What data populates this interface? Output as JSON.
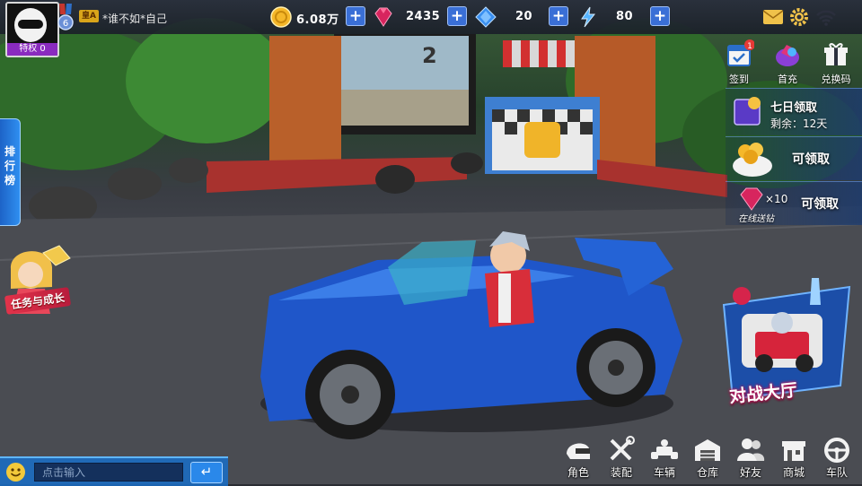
{
  "player": {
    "vip_label": "特权",
    "vip_level": "0",
    "medal_level": "6",
    "rank_badge": "皇A",
    "name": "*谁不如*自己"
  },
  "resources": [
    {
      "name": "coins",
      "icon": "gold-coin-icon",
      "value": "6.08万"
    },
    {
      "name": "red-gems",
      "icon": "red-gem-icon",
      "value": "2435"
    },
    {
      "name": "blue-diamonds",
      "icon": "blue-diamond-icon",
      "value": "20"
    },
    {
      "name": "energy",
      "icon": "lightning-icon",
      "value": "80"
    }
  ],
  "plus_label": "+",
  "side_menu": [
    {
      "label": "签到",
      "icon": "calendar-icon",
      "badge": "1"
    },
    {
      "label": "首充",
      "icon": "gift-gems-icon"
    },
    {
      "label": "兑换码",
      "icon": "gift-box-icon"
    }
  ],
  "rewards": {
    "seven_day": {
      "title": "七日领取",
      "remaining": "剩余：12天"
    },
    "claim_label": "可领取",
    "online_gems": {
      "count": "×10",
      "caption": "在线送钻",
      "claim_label": "可领取"
    }
  },
  "left": {
    "leaderboard_label": "排行榜",
    "task_label": "任务与成长"
  },
  "battle_hall_label": "对战大厅",
  "chat": {
    "placeholder": "点击输入",
    "send_icon": "↵"
  },
  "bottom_nav": [
    {
      "label": "角色",
      "icon": "helmet-icon"
    },
    {
      "label": "装配",
      "icon": "wrench-icon"
    },
    {
      "label": "车辆",
      "icon": "kart-icon"
    },
    {
      "label": "仓库",
      "icon": "warehouse-icon"
    },
    {
      "label": "好友",
      "icon": "friends-icon"
    },
    {
      "label": "商城",
      "icon": "shop-icon"
    },
    {
      "label": "车队",
      "icon": "steering-wheel-icon"
    }
  ],
  "colors": {
    "accent_blue": "#2a88ea",
    "plus_blue": "#3a6fd6",
    "battle_pink": "#c2185b"
  }
}
